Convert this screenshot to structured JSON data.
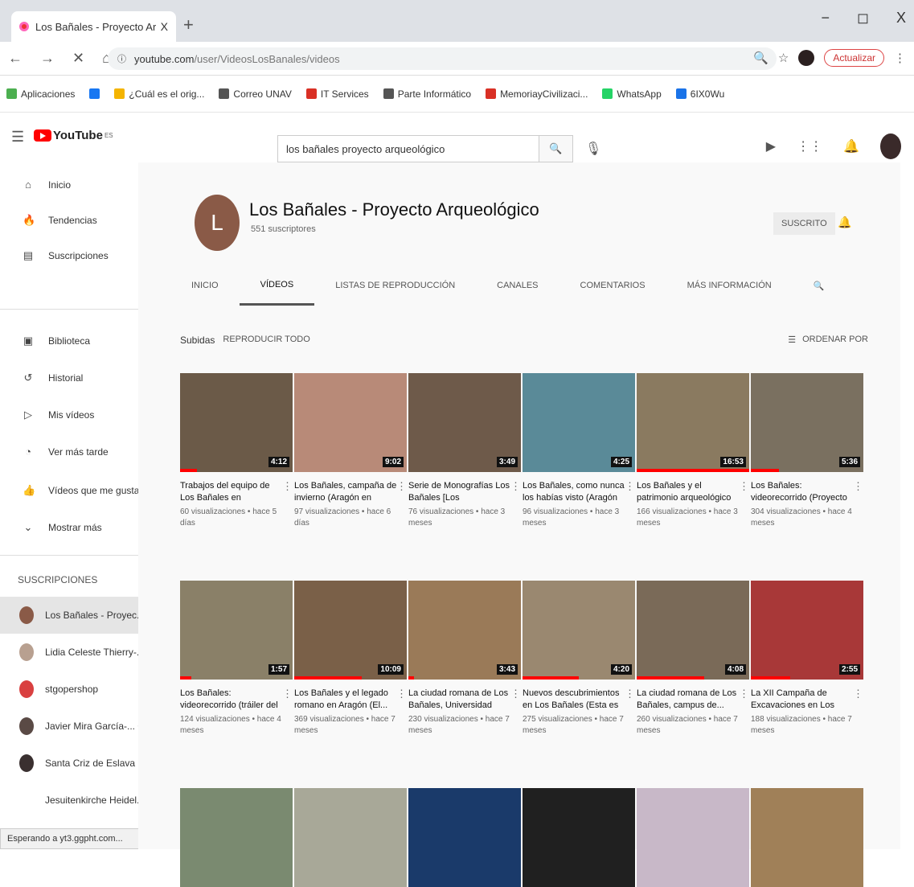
{
  "browser": {
    "tab_title": "Los Bañales - Proyecto Arqueológ",
    "tab_close": "X",
    "new_tab": "+",
    "url_host": "youtube.com",
    "url_path": "/user/VideosLosBanales/videos",
    "update_label": "Actualizar",
    "window_minimize": "−",
    "window_maximize": "◻",
    "window_close": "X"
  },
  "bookmarks": [
    {
      "label": "Aplicaciones",
      "color": "#4caf50"
    },
    {
      "label": "",
      "color": "#1877f2"
    },
    {
      "label": "¿Cuál es el orig...",
      "color": "#f4b400"
    },
    {
      "label": "Correo UNAV",
      "color": "#555555"
    },
    {
      "label": "IT Services",
      "color": "#d93025"
    },
    {
      "label": "Parte Informático",
      "color": "#555555"
    },
    {
      "label": "MemoriayCivilizaci...",
      "color": "#d93025"
    },
    {
      "label": "WhatsApp",
      "color": "#25d366"
    },
    {
      "label": "6IX0Wu",
      "color": "#1a73e8"
    }
  ],
  "youtube": {
    "logo_text": "YouTube",
    "logo_sup": "ES",
    "search_value": "los bañales proyecto arqueológico"
  },
  "sidebar": {
    "main": [
      {
        "label": "Inicio",
        "icon": "⌂"
      },
      {
        "label": "Tendencias",
        "icon": "🔥"
      },
      {
        "label": "Suscripciones",
        "icon": "▤"
      }
    ],
    "library": [
      {
        "label": "Biblioteca",
        "icon": "▣"
      },
      {
        "label": "Historial",
        "icon": "↺"
      },
      {
        "label": "Mis vídeos",
        "icon": "▷"
      },
      {
        "label": "Ver más tarde",
        "icon": "◔"
      },
      {
        "label": "Vídeos que me gustan",
        "icon": "👍"
      },
      {
        "label": "Mostrar más",
        "icon": "⌄"
      }
    ],
    "subs_header": "SUSCRIPCIONES",
    "subscriptions": [
      {
        "label": "Los Bañales - Proyec...",
        "color": "#8a5a47"
      },
      {
        "label": "Lidia Celeste Thierry-...",
        "color": "#b8a090"
      },
      {
        "label": "stgopershop",
        "color": "#d94040"
      },
      {
        "label": "Javier Mira García-... •",
        "color": "#5a4a45"
      },
      {
        "label": "Santa Criz de Eslava",
        "color": "#3a3030"
      },
      {
        "label": "Jesuitenkirche Heidel...",
        "color": "#ffffff"
      }
    ]
  },
  "status_text": "Esperando a yt3.ggpht.com...",
  "channel": {
    "avatar_letter": "L",
    "name": "Los Bañales - Proyecto Arqueológico",
    "subscribers": "551 suscriptores",
    "subscribe_label": "SUSCRITO",
    "tabs": [
      "INICIO",
      "VÍDEOS",
      "LISTAS DE REPRODUCCIÓN",
      "CANALES",
      "COMENTARIOS",
      "MÁS INFORMACIÓN"
    ],
    "selected_tab": "VÍDEOS"
  },
  "uploads": {
    "title": "Subidas",
    "play_all": "REPRODUCIR TODO",
    "sort_label": "ORDENAR POR"
  },
  "videos": [
    {
      "title": "Trabajos del equipo de Los Bañales en Castiliscar...",
      "meta": "60 visualizaciones • hace 5 días",
      "duration": "4:12",
      "thumb": "#6b5a48",
      "progress": 0.15
    },
    {
      "title": "Los Bañales, campaña de invierno (Aragón en Abierto,...",
      "meta": "97 visualizaciones • hace 6 días",
      "duration": "9:02",
      "thumb": "#b88a78",
      "progress": 0
    },
    {
      "title": "Serie de Monografías Los Bañales [Los Bañales/Pórti...",
      "meta": "76 visualizaciones • hace 3 meses",
      "duration": "3:49",
      "thumb": "#6e5a4a",
      "progress": 0
    },
    {
      "title": "Los Bañales, como nunca los habías visto (Aragón en...",
      "meta": "96 visualizaciones • hace 3 meses",
      "duration": "4:25",
      "thumb": "#5a8a98",
      "progress": 0
    },
    {
      "title": "Los Bañales y el patrimonio arqueológico en Aragón...",
      "meta": "166 visualizaciones • hace 3 meses",
      "duration": "16:53",
      "thumb": "#8a7a60",
      "progress": 1
    },
    {
      "title": "Los Bañales: videorecorrido (Proyecto \"Roma renascens...",
      "meta": "304 visualizaciones • hace 4 meses",
      "duration": "5:36",
      "thumb": "#7a7060",
      "progress": 0.25
    },
    {
      "title": "Los Bañales: videorecorrido (tráiler del Proyecto \"Roma...",
      "meta": "124 visualizaciones • hace 4 meses",
      "duration": "1:57",
      "thumb": "#8a8068",
      "progress": 0.1
    },
    {
      "title": "Los Bañales y el legado romano en Aragón (El...",
      "meta": "369 visualizaciones • hace 7 meses",
      "duration": "10:09",
      "thumb": "#7a6048",
      "progress": 0.6
    },
    {
      "title": "La ciudad romana de Los Bañales, Universidad de...",
      "meta": "230 visualizaciones • hace 7 meses",
      "duration": "3:43",
      "thumb": "#9a7a58",
      "progress": 0.05
    },
    {
      "title": "Nuevos descubrimientos en Los Bañales (Esta es mi...",
      "meta": "275 visualizaciones • hace 7 meses",
      "duration": "4:20",
      "thumb": "#9a8870",
      "progress": 0.5
    },
    {
      "title": "La ciudad romana de Los Bañales, campus de...",
      "meta": "260 visualizaciones • hace 7 meses",
      "duration": "4:08",
      "thumb": "#7a6a58",
      "progress": 0.6
    },
    {
      "title": "La XII Campaña de Excavaciones en Los Bañal...",
      "meta": "188 visualizaciones • hace 7 meses",
      "duration": "2:55",
      "thumb": "#a83838",
      "progress": 0.35
    },
    {
      "title": "",
      "meta": "",
      "duration": "",
      "thumb": "#7a8a70",
      "progress": 0
    },
    {
      "title": "",
      "meta": "",
      "duration": "",
      "thumb": "#a8a898",
      "progress": 0
    },
    {
      "title": "",
      "meta": "",
      "duration": "",
      "thumb": "#1a3a6a",
      "progress": 0
    },
    {
      "title": "",
      "meta": "",
      "duration": "",
      "thumb": "#202020",
      "progress": 0
    },
    {
      "title": "",
      "meta": "",
      "duration": "",
      "thumb": "#c8b8c8",
      "progress": 0
    },
    {
      "title": "",
      "meta": "",
      "duration": "",
      "thumb": "#a08058",
      "progress": 0
    }
  ]
}
